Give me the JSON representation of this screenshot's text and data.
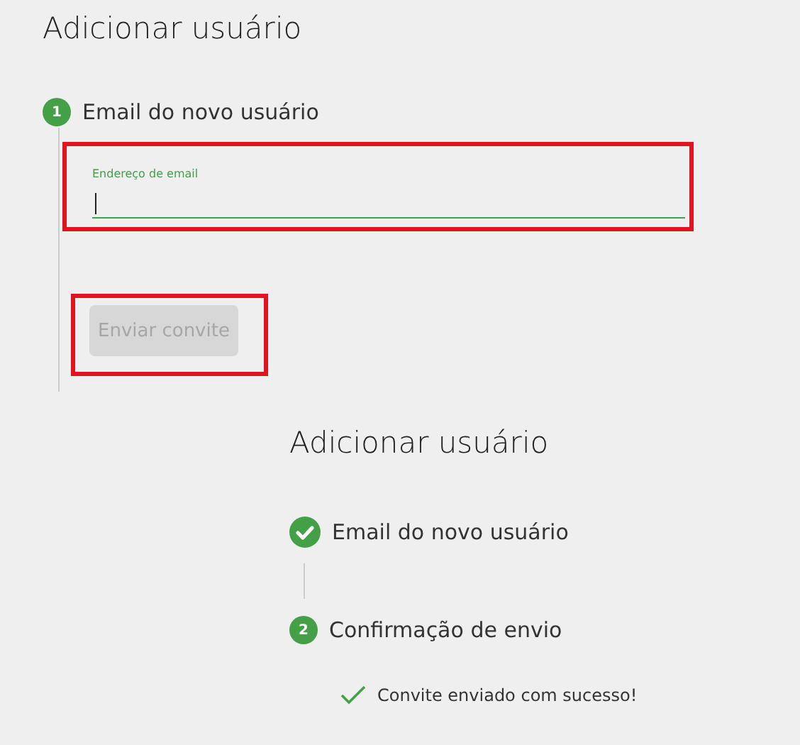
{
  "panels": [
    {
      "title": "Adicionar usuário",
      "steps": [
        {
          "number": "1",
          "label": "Email do novo usuário",
          "done": false
        }
      ],
      "email_field": {
        "label": "Endereço de email",
        "focused": true,
        "highlighted": true
      },
      "send_button": {
        "label": "Enviar convite",
        "disabled": true,
        "highlighted": true
      }
    },
    {
      "title": "Adicionar usuário",
      "steps": [
        {
          "label": "Email do novo usuário",
          "done": true
        },
        {
          "number": "2",
          "label": "Confirmação de envio",
          "done": false
        }
      ],
      "success_message": "Convite enviado com sucesso!"
    }
  ]
}
